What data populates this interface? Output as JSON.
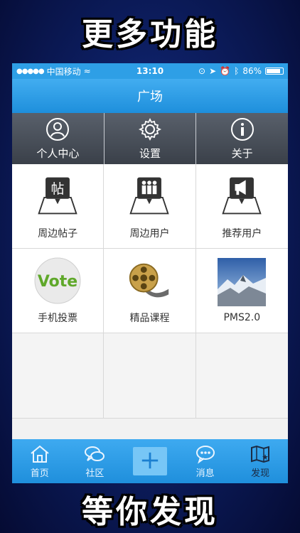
{
  "promo": {
    "top": "更多功能",
    "bottom": "等你发现"
  },
  "status": {
    "carrier": "中国移动",
    "time": "13:10",
    "battery": "86%"
  },
  "navbar": {
    "title": "广场"
  },
  "top_menu": [
    {
      "label": "个人中心",
      "icon": "person-icon"
    },
    {
      "label": "设置",
      "icon": "gear-icon"
    },
    {
      "label": "关于",
      "icon": "info-icon"
    }
  ],
  "grid": [
    {
      "label": "周边帖子",
      "icon": "nearby-posts-icon"
    },
    {
      "label": "周边用户",
      "icon": "nearby-users-icon"
    },
    {
      "label": "推荐用户",
      "icon": "recommend-users-icon"
    },
    {
      "label": "手机投票",
      "icon": "vote-icon",
      "icon_text": "Vote"
    },
    {
      "label": "精品课程",
      "icon": "film-reel-icon"
    },
    {
      "label": "PMS2.0",
      "icon": "mountain-photo-icon"
    }
  ],
  "tabbar": [
    {
      "label": "首页",
      "icon": "home-icon"
    },
    {
      "label": "社区",
      "icon": "community-icon"
    },
    {
      "label": "",
      "icon": "plus-icon"
    },
    {
      "label": "消息",
      "icon": "message-icon"
    },
    {
      "label": "发现",
      "icon": "discover-icon",
      "active": true
    }
  ]
}
